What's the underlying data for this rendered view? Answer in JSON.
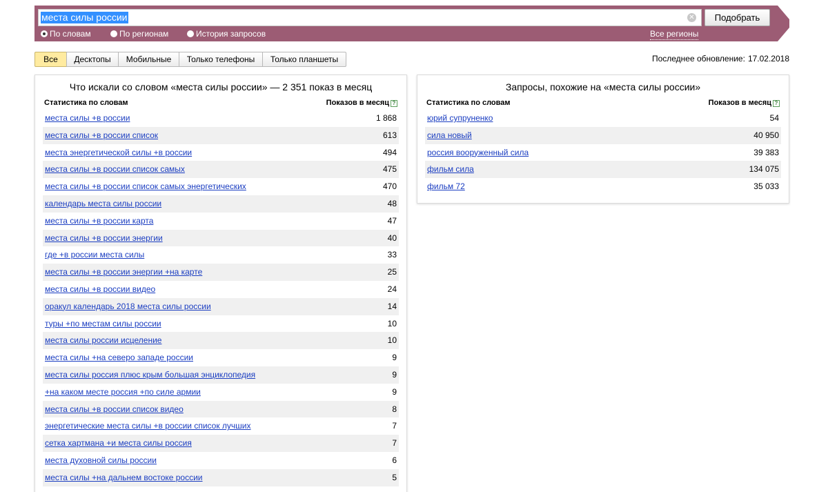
{
  "search": {
    "query": "места силы россии",
    "submit_label": "Подобрать"
  },
  "radio_options": [
    {
      "label": "По словам",
      "checked": true
    },
    {
      "label": "По регионам",
      "checked": false
    },
    {
      "label": "История запросов",
      "checked": false
    }
  ],
  "regions_link": "Все регионы",
  "tabs": [
    "Все",
    "Десктопы",
    "Мобильные",
    "Только телефоны",
    "Только планшеты"
  ],
  "updated": {
    "label": "Последнее обновление:",
    "date": "17.02.2018"
  },
  "left_panel": {
    "title": "Что искали со словом «места силы россии» — 2 351 показ в месяц",
    "col_words": "Статистика по словам",
    "col_count": "Показов в месяц",
    "rows": [
      {
        "phrase": "места силы +в россии",
        "count": "1 868"
      },
      {
        "phrase": "места силы +в россии список",
        "count": "613"
      },
      {
        "phrase": "места энергетической силы +в россии",
        "count": "494"
      },
      {
        "phrase": "места силы +в россии список самых",
        "count": "475"
      },
      {
        "phrase": "места силы +в россии список самых энергетических",
        "count": "470"
      },
      {
        "phrase": "календарь места силы россии",
        "count": "48"
      },
      {
        "phrase": "места силы +в россии карта",
        "count": "47"
      },
      {
        "phrase": "места силы +в россии энергии",
        "count": "40"
      },
      {
        "phrase": "где +в россии места силы",
        "count": "33"
      },
      {
        "phrase": "места силы +в россии энергии +на карте",
        "count": "25"
      },
      {
        "phrase": "места силы +в россии видео",
        "count": "24"
      },
      {
        "phrase": "оракул календарь 2018 места силы россии",
        "count": "14"
      },
      {
        "phrase": "туры +по местам силы россии",
        "count": "10"
      },
      {
        "phrase": "места силы россии исцеление",
        "count": "10"
      },
      {
        "phrase": "места силы +на северо западе россии",
        "count": "9"
      },
      {
        "phrase": "места силы россия плюс крым большая энциклопедия",
        "count": "9"
      },
      {
        "phrase": "+на каком месте россия +по силе армии",
        "count": "9"
      },
      {
        "phrase": "места силы +в россии список видео",
        "count": "8"
      },
      {
        "phrase": "энергетические места силы +в россии список лучших",
        "count": "7"
      },
      {
        "phrase": "сетка хартмана +и места силы россия",
        "count": "7"
      },
      {
        "phrase": "места духовной силы россии",
        "count": "6"
      },
      {
        "phrase": "места силы +на дальнем востоке россии",
        "count": "5"
      }
    ]
  },
  "right_panel": {
    "title": "Запросы, похожие на «места силы россии»",
    "col_words": "Статистика по словам",
    "col_count": "Показов в месяц",
    "rows": [
      {
        "phrase": "юрий супруненко",
        "count": "54"
      },
      {
        "phrase": "сила новый",
        "count": "40 950"
      },
      {
        "phrase": "россия вооруженный сила",
        "count": "39 383"
      },
      {
        "phrase": "фильм сила",
        "count": "134 075"
      },
      {
        "phrase": "фильм 72",
        "count": "35 033"
      }
    ]
  },
  "icons": {
    "clear": "clear-icon",
    "help": "help-icon"
  },
  "colors": {
    "header": "#9c5c74",
    "link": "#1a3dc1",
    "active_tab": "#ffeba0",
    "selection": "#3390ff"
  }
}
